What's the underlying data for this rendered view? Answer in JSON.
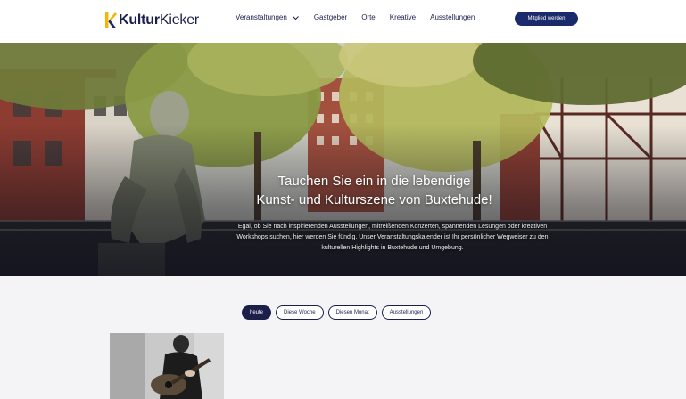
{
  "header": {
    "logo_bold": "Kultur",
    "logo_light": "Kieker",
    "nav": [
      {
        "label": "Veranstaltungen",
        "has_dropdown": true
      },
      {
        "label": "Gastgeber"
      },
      {
        "label": "Orte"
      },
      {
        "label": "Kreative"
      },
      {
        "label": "Ausstellungen"
      }
    ],
    "cta_label": "Mitglied werden"
  },
  "hero": {
    "title": "Tauchen Sie ein in die lebendige\nKunst- und Kulturszene von Buxtehude!",
    "text": "Egal, ob Sie nach inspirierenden Ausstellungen, mitreißenden Konzerten, spannenden Lesungen oder kreativen Workshops suchen, hier werden Sie fündig. Unser Veranstaltungskalender ist Ihr persönlicher Wegweiser zu den kulturellen Highlights in Buxtehude und Umgebung."
  },
  "filters": {
    "tabs": [
      {
        "label": "heute",
        "active": true
      },
      {
        "label": "Diese Woche"
      },
      {
        "label": "Diesen Monat"
      },
      {
        "label": "Ausstellungen"
      }
    ]
  },
  "colors": {
    "brand_navy": "#1b1f4a",
    "cta_blue": "#1b2a6b",
    "logo_yellow": "#f2b705"
  }
}
